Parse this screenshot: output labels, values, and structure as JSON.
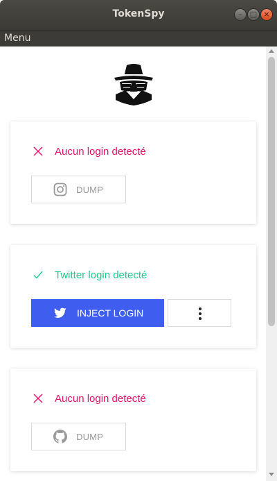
{
  "window": {
    "title": "TokenSpy",
    "controls": {
      "minimize": "–",
      "maximize": "□",
      "close": "×"
    }
  },
  "menubar": {
    "menu_label": "Menu"
  },
  "logo": {
    "icon": "spy-icon"
  },
  "colors": {
    "fail": "#e4126b",
    "success": "#1ccc8d",
    "primary_button": "#3f5ef0"
  },
  "cards": [
    {
      "status": "fail",
      "status_icon": "cross-icon",
      "status_text": "Aucun login detecté",
      "button_icon": "instagram-icon",
      "button_label": "DUMP"
    },
    {
      "status": "success",
      "status_icon": "check-icon",
      "status_text": "Twitter login detecté",
      "button_icon": "twitter-icon",
      "button_label": "INJECT LOGIN",
      "more_icon": "more-vertical-icon"
    },
    {
      "status": "fail",
      "status_icon": "cross-icon",
      "status_text": "Aucun login detecté",
      "button_icon": "github-icon",
      "button_label": "DUMP"
    }
  ]
}
